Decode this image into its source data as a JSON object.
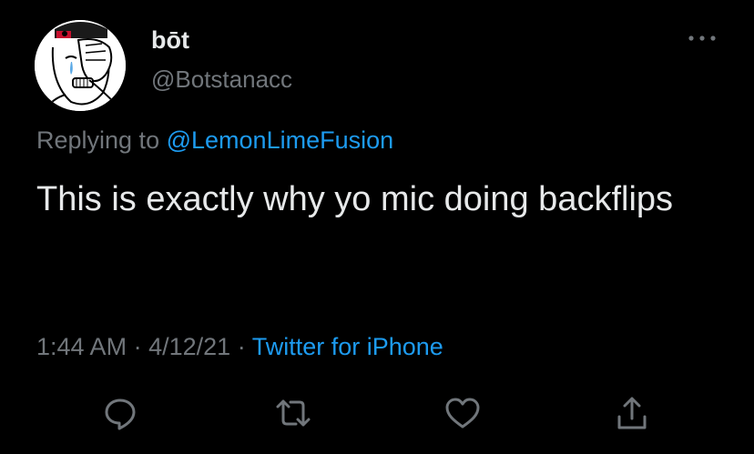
{
  "user": {
    "display_name": "bōt",
    "handle": "@Botstanacc",
    "avatar_icon": "crying-wojak-avatar"
  },
  "reply": {
    "prefix": "Replying to",
    "mention": "@LemonLimeFusion"
  },
  "tweet": {
    "text": "This is exactly why yo mic doing backflips"
  },
  "meta": {
    "time": "1:44 AM",
    "separator": "·",
    "date": "4/12/21",
    "source": "Twitter for iPhone"
  },
  "actions": [
    {
      "icon": "reply-icon"
    },
    {
      "icon": "retweet-icon"
    },
    {
      "icon": "like-icon"
    },
    {
      "icon": "share-icon"
    }
  ],
  "colors": {
    "background": "#000000",
    "primary_text": "#e7e9ea",
    "secondary_text": "#71767b",
    "accent": "#1d9bf0"
  }
}
